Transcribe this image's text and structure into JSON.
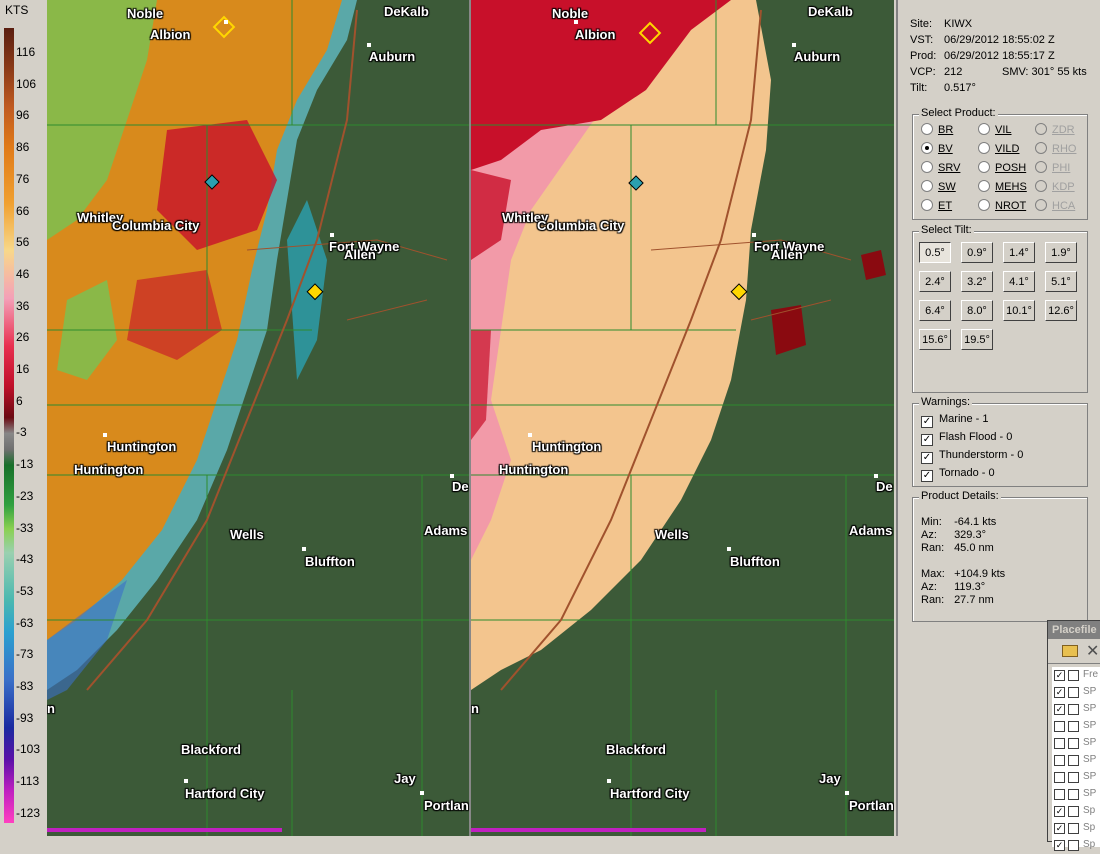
{
  "scale": {
    "unit": "KTS",
    "ticks": [
      "116",
      "106",
      "96",
      "86",
      "76",
      "66",
      "56",
      "46",
      "36",
      "26",
      "16",
      "6",
      "-3",
      "-13",
      "-23",
      "-33",
      "-43",
      "-53",
      "-63",
      "-73",
      "-83",
      "-93",
      "-103",
      "-113",
      "-123"
    ]
  },
  "left_pane": {
    "cities": [
      "Noble",
      "Albion",
      "DeKalb",
      "Auburn",
      "Whitley",
      "Columbia City",
      "Fort Wayne",
      "Allen",
      "Huntington",
      "Huntington",
      "Wells",
      "Bluffton",
      "Adams",
      "Blackford",
      "Hartford City",
      "Jay",
      "Portlan",
      "De",
      "n",
      "n"
    ]
  },
  "right_pane": {
    "cities": [
      "Noble",
      "Albion",
      "DeKalb",
      "Auburn",
      "Whitley",
      "Columbia City",
      "Fort Wayne",
      "Allen",
      "Huntington",
      "Huntington",
      "Wells",
      "Bluffton",
      "Adams",
      "Blackford",
      "Hartford City",
      "Jay",
      "Portlan",
      "De",
      "n"
    ]
  },
  "info": {
    "site_label": "Site:",
    "site": "KIWX",
    "vst_label": "VST:",
    "vst": "06/29/2012  18:55:02 Z",
    "prod_label": "Prod:",
    "prod": "06/29/2012  18:55:17 Z",
    "vcp_label": "VCP:",
    "vcp": "212",
    "smv": "SMV: 301° 55 kts",
    "tilt_label": "Tilt:",
    "tilt": "0.517°"
  },
  "product": {
    "legend": "Select Product:",
    "options": [
      {
        "label": "BR",
        "on": false,
        "enabled": true
      },
      {
        "label": "VIL",
        "on": false,
        "enabled": true
      },
      {
        "label": "ZDR",
        "on": false,
        "enabled": false
      },
      {
        "label": "BV",
        "on": true,
        "enabled": true
      },
      {
        "label": "VILD",
        "on": false,
        "enabled": true
      },
      {
        "label": "RHO",
        "on": false,
        "enabled": false
      },
      {
        "label": "SRV",
        "on": false,
        "enabled": true
      },
      {
        "label": "POSH",
        "on": false,
        "enabled": true
      },
      {
        "label": "PHI",
        "on": false,
        "enabled": false
      },
      {
        "label": "SW",
        "on": false,
        "enabled": true
      },
      {
        "label": "MEHS",
        "on": false,
        "enabled": true
      },
      {
        "label": "KDP",
        "on": false,
        "enabled": false
      },
      {
        "label": "ET",
        "on": false,
        "enabled": true
      },
      {
        "label": "NROT",
        "on": false,
        "enabled": true
      },
      {
        "label": "HCA",
        "on": false,
        "enabled": false
      }
    ]
  },
  "tilt": {
    "legend": "Select Tilt:",
    "buttons": [
      "0.5°",
      "0.9°",
      "1.4°",
      "1.9°",
      "2.4°",
      "3.2°",
      "4.1°",
      "5.1°",
      "6.4°",
      "8.0°",
      "10.1°",
      "12.6°",
      "15.6°",
      "19.5°"
    ],
    "selected": "0.5°"
  },
  "warnings": {
    "legend": "Warnings:",
    "items": [
      "Marine - 1",
      "Flash Flood - 0",
      "Thunderstorm - 0",
      "Tornado - 0"
    ]
  },
  "details": {
    "legend": "Product Details:",
    "min_label": "Min:",
    "min": "-64.1 kts",
    "az1_label": "Az:",
    "az1": "329.3°",
    "ran1_label": "Ran:",
    "ran1": "45.0 nm",
    "max_label": "Max:",
    "max": "+104.9 kts",
    "az2_label": "Az:",
    "az2": "119.3°",
    "ran2_label": "Ran:",
    "ran2": "27.7 nm"
  },
  "placefile": {
    "title": "Placefile",
    "items": [
      "Fre",
      "SP",
      "SP",
      "SP",
      "SP",
      "SP",
      "SP",
      "SP",
      "Sp",
      "Sp",
      "Sp"
    ],
    "checked": [
      true,
      true,
      true,
      false,
      false,
      false,
      false,
      false,
      true,
      true,
      true
    ]
  },
  "colors": {
    "inbound_green": "#3c5a38",
    "outbound_orange": "#d88a1c",
    "outbound_peach": "#f3c58e",
    "outbound_red": "#c8102a",
    "county_line": "#2e8b2e",
    "road": "#a0522d"
  }
}
